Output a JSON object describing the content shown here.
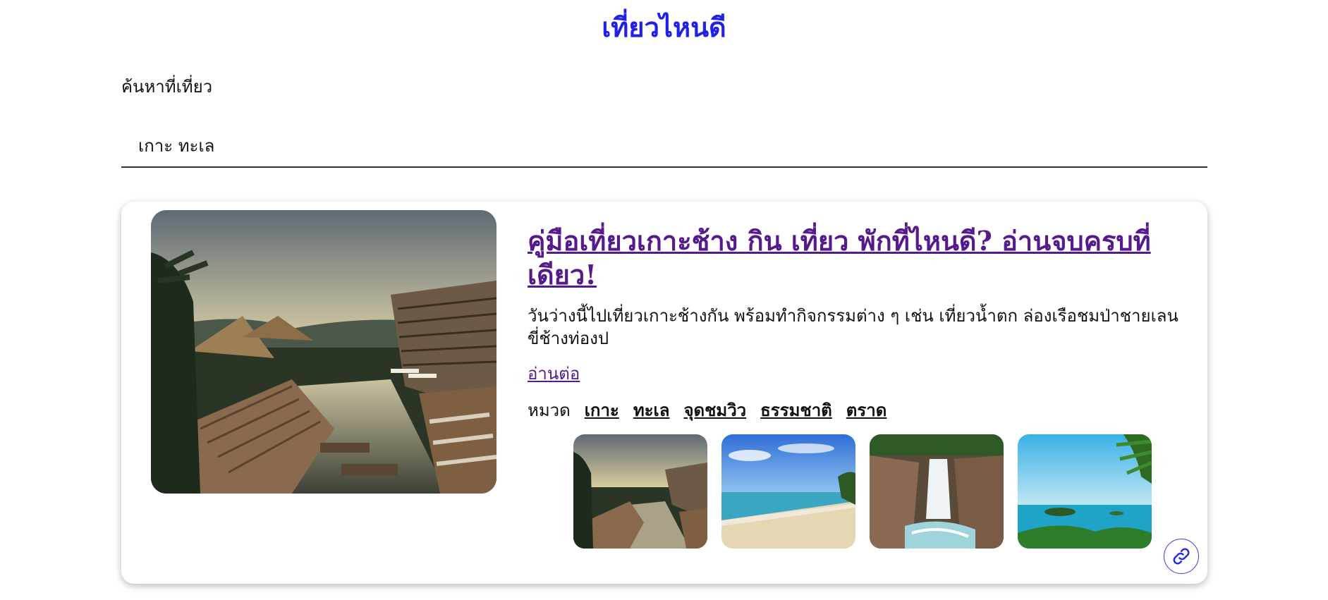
{
  "site": {
    "title": "เที่ยวไหนดี"
  },
  "search": {
    "label": "ค้นหาที่เที่ยว",
    "value": "เกาะ ทะเล"
  },
  "card": {
    "title": "คู่มือเที่ยวเกาะช้าง กิน เที่ยว พักที่ไหนดี? อ่านจบครบที่เดียว!",
    "excerpt": "วันว่างนี้ไปเที่ยวเกาะช้างกัน พร้อมทำกิจกรรมต่าง ๆ เช่น เที่ยวน้ำตก ล่องเรือชมป่าชายเลน ขี่ช้างท่องป",
    "read_more": "อ่านต่อ",
    "category_label": "หมวด",
    "tags": [
      "เกาะ",
      "ทะเล",
      "จุดชมวิว",
      "ธรรมชาติ",
      "ตราด"
    ],
    "link_icon": "link-icon"
  },
  "colors": {
    "title_blue": "#2020e8",
    "visited_link": "#551a8b"
  }
}
